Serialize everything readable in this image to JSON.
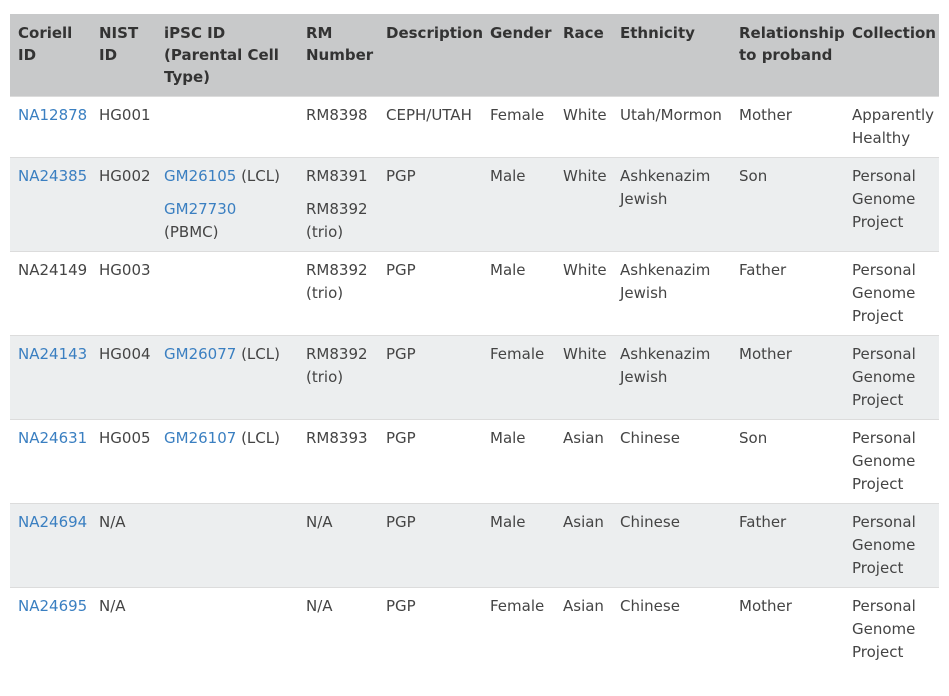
{
  "table": {
    "headers": [
      "Coriell ID",
      "NIST ID",
      "iPSC ID (Parental Cell Type)",
      "RM Number",
      "Description",
      "Gender",
      "Race",
      "Ethnicity",
      "Relationship to proband",
      "Collection"
    ],
    "rows": [
      {
        "coriell": "NA12878",
        "coriell_link": true,
        "nist": "HG001",
        "ipsc": [],
        "rm": [
          "RM8398"
        ],
        "description": "CEPH/UTAH",
        "gender": "Female",
        "race": "White",
        "ethnicity": "Utah/Mormon",
        "relationship": "Mother",
        "collection": "Apparently Healthy"
      },
      {
        "coriell": "NA24385",
        "coriell_link": true,
        "nist": "HG002",
        "ipsc": [
          {
            "id": "GM26105",
            "type": " (LCL)"
          },
          {
            "id": "GM27730",
            "type": " (PBMC)"
          }
        ],
        "rm": [
          "RM8391",
          "RM8392 (trio)"
        ],
        "description": "PGP",
        "gender": "Male",
        "race": "White",
        "ethnicity": "Ashkenazim Jewish",
        "relationship": "Son",
        "collection": "Personal Genome Project"
      },
      {
        "coriell": "NA24149",
        "coriell_link": false,
        "nist": "HG003",
        "ipsc": [],
        "rm": [
          "RM8392 (trio)"
        ],
        "description": "PGP",
        "gender": "Male",
        "race": "White",
        "ethnicity": "Ashkenazim Jewish",
        "relationship": "Father",
        "collection": "Personal Genome Project"
      },
      {
        "coriell": "NA24143",
        "coriell_link": true,
        "nist": "HG004",
        "ipsc": [
          {
            "id": "GM26077",
            "type": " (LCL)"
          }
        ],
        "rm": [
          "RM8392 (trio)"
        ],
        "description": "PGP",
        "gender": "Female",
        "race": "White",
        "ethnicity": "Ashkenazim Jewish",
        "relationship": "Mother",
        "collection": "Personal Genome Project"
      },
      {
        "coriell": "NA24631",
        "coriell_link": true,
        "nist": "HG005",
        "ipsc": [
          {
            "id": "GM26107",
            "type": " (LCL)"
          }
        ],
        "rm": [
          "RM8393"
        ],
        "description": "PGP",
        "gender": "Male",
        "race": "Asian",
        "ethnicity": "Chinese",
        "relationship": "Son",
        "collection": "Personal Genome Project"
      },
      {
        "coriell": "NA24694",
        "coriell_link": true,
        "nist": "N/A",
        "ipsc": [],
        "rm": [
          "N/A"
        ],
        "description": "PGP",
        "gender": "Male",
        "race": "Asian",
        "ethnicity": "Chinese",
        "relationship": "Father",
        "collection": "Personal Genome Project"
      },
      {
        "coriell": "NA24695",
        "coriell_link": true,
        "nist": "N/A",
        "ipsc": [],
        "rm": [
          "N/A"
        ],
        "description": "PGP",
        "gender": "Female",
        "race": "Asian",
        "ethnicity": "Chinese",
        "relationship": "Mother",
        "collection": "Personal Genome Project"
      }
    ]
  },
  "colors": {
    "header_bg": "#c8c9ca",
    "stripe_bg": "#eceeef",
    "link": "#3a7fc1",
    "text": "#444444"
  }
}
